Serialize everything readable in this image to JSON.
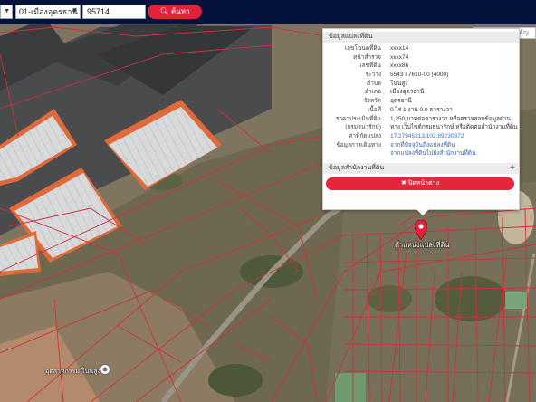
{
  "search": {
    "district": "01-เมืองอุดรธานี",
    "parcel_no": "95714",
    "button_label": "ค้นหา"
  },
  "place_search": {
    "placeholder": "ค้นหาสถานที่สำคัญ"
  },
  "popup": {
    "section1_title": "ข้อมูลแปลงที่ดิน",
    "rows": [
      {
        "key": "เลขโฉนดที่ดิน",
        "value": "xxxx14"
      },
      {
        "key": "หน้าสำรวจ",
        "value": "xxxx74"
      },
      {
        "key": "เลขที่ดิน",
        "value": "xxxx86"
      },
      {
        "key": "ระวาง",
        "value": "5543 I 7610-00 (4000)"
      },
      {
        "key": "ตำบล",
        "value": "โนนสูง"
      },
      {
        "key": "อำเภอ",
        "value": "เมืองอุดรธานี"
      },
      {
        "key": "จังหวัด",
        "value": "อุดรธานี"
      },
      {
        "key": "เนื้อที่",
        "value": "0 ไร่ 1 งาน 0.0 ตารางวา"
      },
      {
        "key": "ราคาประเมินที่ดิน",
        "value": "1,250 บาทต่อตารางวา หรือตรวจสอบข้อมูลผ่าน"
      },
      {
        "key": "(กรมธนารักษ์)",
        "value": "ทาง เว็บไซต์กรมธนารักษ์ หรือติดต่อสำนักงานที่ดิน"
      },
      {
        "key": "ค่าพิกัดแปลง",
        "value": "17.27945313,102.89230872"
      },
      {
        "key": "ข้อมูลการเดินทาง",
        "value": "จากที่ปัจจุบันถึงแปลงที่ดิน"
      },
      {
        "key": "",
        "value": "จากแปลงที่ดินไปยังสำนักงานที่ดิน"
      }
    ],
    "section2_title": "ข้อมูลสำนักงานที่ดิน",
    "section2_toggle": "+",
    "close_label": "ปิดหน้าต่าง"
  },
  "marker": {
    "label": "ตำแหน่งแปลงที่ดิน"
  },
  "poi": {
    "label": "อุตสาหกรรม โนนสูง"
  },
  "colors": {
    "topbar": "#05123a",
    "accent": "#e0223a",
    "parcel_line": "#d0303a",
    "link": "#2f5fb6"
  }
}
